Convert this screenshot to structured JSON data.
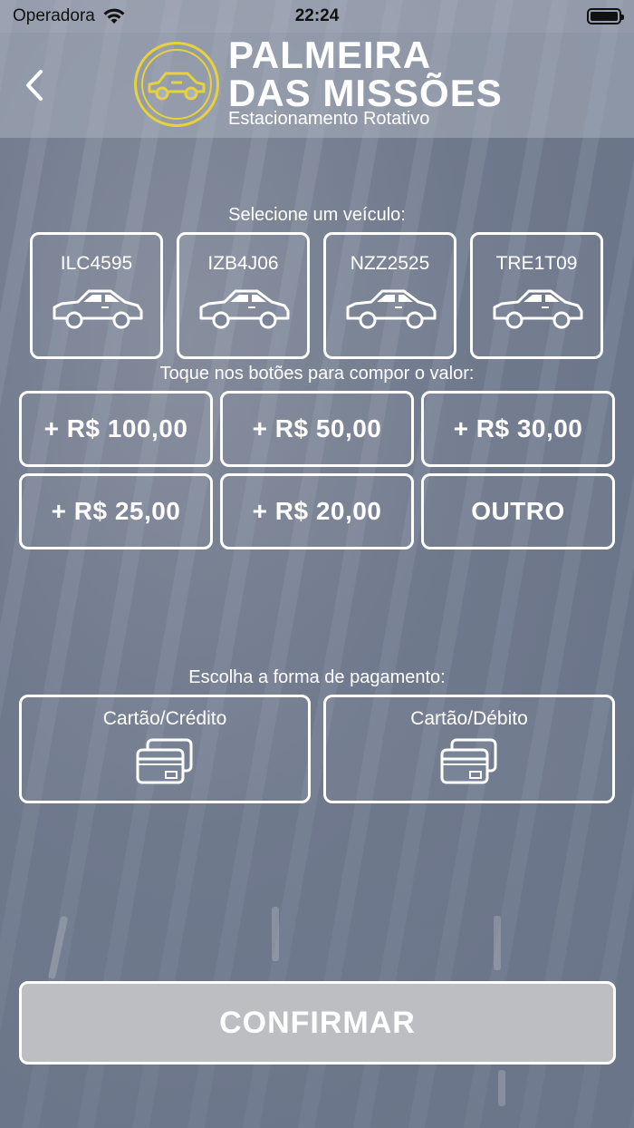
{
  "status_bar": {
    "carrier": "Operadora",
    "time": "22:24"
  },
  "header": {
    "title_line1": "PALMEIRA",
    "title_line2": "DAS MISSÕES",
    "subtitle": "Estacionamento Rotativo"
  },
  "vehicles": {
    "label": "Selecione um veículo:",
    "items": [
      {
        "plate": "ILC4595"
      },
      {
        "plate": "IZB4J06"
      },
      {
        "plate": "NZZ2525"
      },
      {
        "plate": "TRE1T09"
      }
    ]
  },
  "amounts": {
    "label": "Toque nos botões para compor o valor:",
    "buttons": [
      "+ R$ 100,00",
      "+ R$ 50,00",
      "+ R$ 30,00",
      "+ R$ 25,00",
      "+ R$ 20,00",
      "OUTRO"
    ]
  },
  "payment": {
    "label": "Escolha a forma de pagamento:",
    "methods": [
      {
        "label": "Cartão/Crédito",
        "icon": "credit-cards-icon"
      },
      {
        "label": "Cartão/Débito",
        "icon": "credit-cards-icon"
      }
    ]
  },
  "confirm_label": "CONFIRMAR",
  "colors": {
    "logo_ring": "#e8d23a",
    "confirm_bg": "#bcbec1",
    "outline": "#ffffff"
  }
}
